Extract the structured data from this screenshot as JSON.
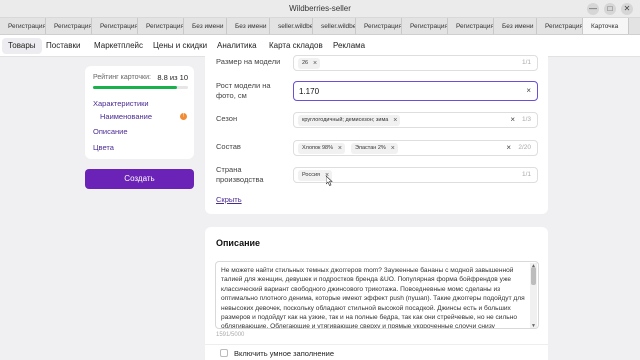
{
  "window": {
    "title": "Wildberries-seller",
    "minimize": "—",
    "maximize": "□",
    "close": "✕"
  },
  "browser_tabs": [
    "Регистрация",
    "Регистрация",
    "Регистрация",
    "Регистрация",
    "Без имени",
    "Без имени",
    "seller.wildbe",
    "seller.wildbe",
    "Регистрация",
    "Регистрация",
    "Регистрация",
    "Без имени",
    "Регистрация",
    "Карточка"
  ],
  "nav": {
    "items": [
      "Товары",
      "Поставки",
      "Маркетплейс",
      "Цены и скидки",
      "Аналитика",
      "Карта складов",
      "Реклама"
    ],
    "active": "Товары"
  },
  "sidebar": {
    "rating_label": "Рейтинг карточки:",
    "rating_value": "8.8 из 10",
    "rating_fraction": 0.88,
    "links": {
      "characteristics": "Характеристики",
      "name": "Наименование",
      "description": "Описание",
      "colors": "Цвета"
    },
    "badge": "!",
    "create_button": "Создать"
  },
  "fields": {
    "size": {
      "label": "Размер на модели",
      "chips": [
        "26"
      ],
      "count": "1/1"
    },
    "height": {
      "label": "Рост модели на фото, см",
      "value": "1.170"
    },
    "season": {
      "label": "Сезон",
      "chips": [
        "круглогодичный; демисезон; зима"
      ],
      "count": "1/3"
    },
    "composition": {
      "label": "Состав",
      "chips": [
        "Хлопок 98%",
        "Эластан 2%"
      ],
      "count": "2/20"
    },
    "country": {
      "label": "Страна производства",
      "chips": [
        "Россия"
      ],
      "count": "1/1"
    },
    "hide_link": "Скрыть"
  },
  "description": {
    "title": "Описание",
    "text": "Не можете найти стильных темных джоггеров mom? Зауженные бананы с модной завышенной талией для женщин, девушек и подростков бренда &UO. Популярная форма бойфрендов уже классический вариант свободного джинсового трикотажа. Повседневные момс сделаны из оптимально плотного денима, которые имеют эффект push (пушап). Такие джоггеры подойдут для невысоких девочек, поскольку обладают стильной высокой посадкой. Джинсы есть и больших размеров и подойдут как на узкие, так и на полные бедра, так как они стрейчевые, но не сильно облягивающие. Облегающие и утягивающие сверху и прямые укороченные слоучи снизу понравятся представительницам plus size.",
    "counter": "1591/5000",
    "smart_fill": "Включить умное заполнение"
  },
  "colors": {
    "accent": "#6b22b6",
    "rating": "#19b24a",
    "badge": "#f08c34",
    "link": "#4a2b92"
  }
}
